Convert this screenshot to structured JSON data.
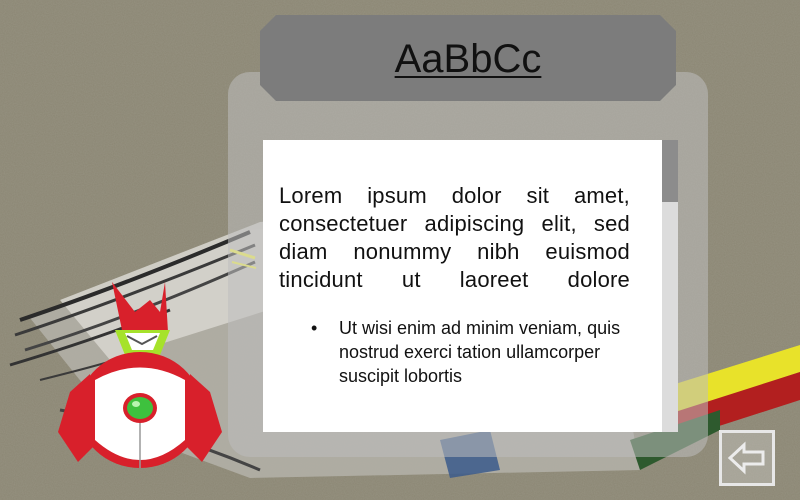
{
  "header": {
    "title": "AaBbCc"
  },
  "content": {
    "paragraph": "Lorem ipsum dolor sit amet, consectetuer adipiscing elit, sed diam nonummy nibh euismod tincidunt ut laoreet dolore",
    "bullets": [
      "Ut wisi enim ad minim veniam, quis nostrud exerci tation ullamcorper suscipit lobortis"
    ],
    "scroll_position": 0
  },
  "nav": {
    "back_icon": "back-arrow-icon"
  },
  "colors": {
    "background": "#8a8572",
    "title_bar": "#7c7c7c",
    "panel": "#bebebe",
    "robot_red": "#d8202b",
    "robot_green": "#a6e22b"
  }
}
